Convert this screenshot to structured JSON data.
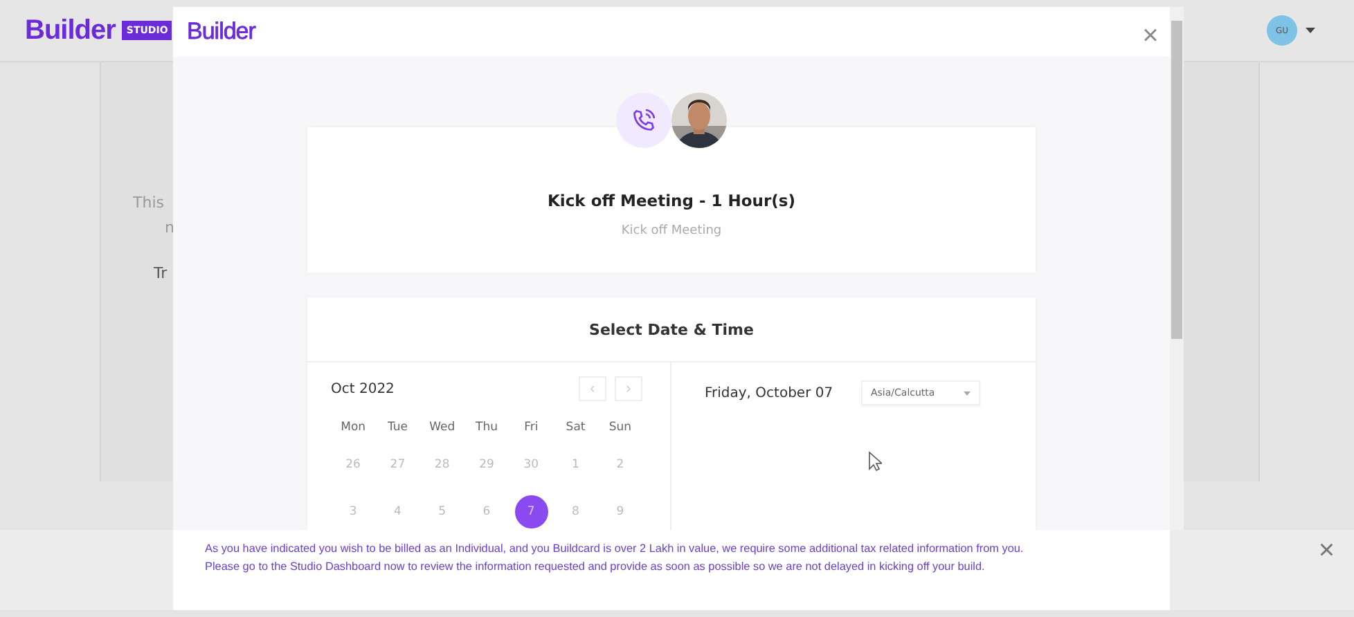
{
  "header": {
    "logo": "Builder",
    "logo_badge": "STUDIO",
    "avatar_initials": "GU"
  },
  "background_card": {
    "lines": [
      "This",
      "n",
      "Tr"
    ]
  },
  "modal": {
    "logo": "Builder",
    "close": "×",
    "meeting": {
      "title": "Kick off Meeting - 1 Hour(s)",
      "subtitle": "Kick off Meeting"
    },
    "scheduler": {
      "title": "Select Date & Time",
      "month": "Oct 2022",
      "prev": "‹",
      "next": "›",
      "weekdays": [
        "Mon",
        "Tue",
        "Wed",
        "Thu",
        "Fri",
        "Sat",
        "Sun"
      ],
      "weeks": [
        [
          {
            "day": "26",
            "selected": false
          },
          {
            "day": "27",
            "selected": false
          },
          {
            "day": "28",
            "selected": false
          },
          {
            "day": "29",
            "selected": false
          },
          {
            "day": "30",
            "selected": false
          },
          {
            "day": "1",
            "selected": false
          },
          {
            "day": "2",
            "selected": false
          }
        ],
        [
          {
            "day": "3",
            "selected": false
          },
          {
            "day": "4",
            "selected": false
          },
          {
            "day": "5",
            "selected": false
          },
          {
            "day": "6",
            "selected": false
          },
          {
            "day": "7",
            "selected": true
          },
          {
            "day": "8",
            "selected": false
          },
          {
            "day": "9",
            "selected": false
          }
        ]
      ],
      "selected_date": "Friday, October 07",
      "timezone": "Asia/Calcutta"
    }
  },
  "banner": {
    "message": "As you have indicated you wish to be billed as an Individual, and you Buildcard is over 2 Lakh in value, we require some additional tax related information from you. Please go to the Studio Dashboard now to review the information requested and provide as soon as possible so we are not delayed in kicking off your build.",
    "close": "×"
  }
}
